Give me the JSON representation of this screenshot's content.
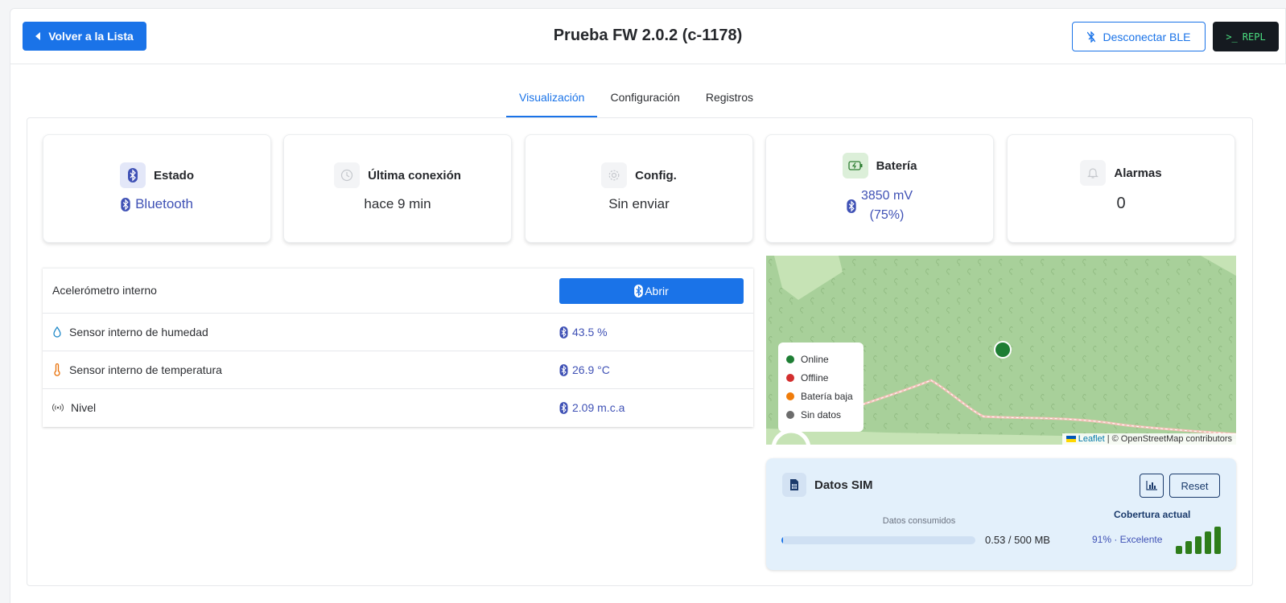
{
  "header": {
    "back_label": "Volver a la Lista",
    "title": "Prueba FW 2.0.2 (c-1178)",
    "ble_label": "Desconectar BLE",
    "repl_label": "REPL"
  },
  "tabs": [
    {
      "label": "Visualización",
      "active": true
    },
    {
      "label": "Configuración",
      "active": false
    },
    {
      "label": "Registros",
      "active": false
    }
  ],
  "cards": {
    "estado": {
      "title": "Estado",
      "value": "Bluetooth"
    },
    "ultima": {
      "title": "Última conexión",
      "value": "hace 9 min"
    },
    "config": {
      "title": "Config.",
      "value": "Sin enviar"
    },
    "bateria": {
      "title": "Batería",
      "value_line1": "3850 mV",
      "value_line2": "(75%)"
    },
    "alarmas": {
      "title": "Alarmas",
      "value": "0"
    }
  },
  "sensors": {
    "accel": {
      "label": "Acelerómetro interno",
      "button": "Abrir"
    },
    "humidity": {
      "label": "Sensor interno de humedad",
      "value": "43.5 %"
    },
    "temperature": {
      "label": "Sensor interno de temperatura",
      "value": "26.9 °C"
    },
    "level": {
      "label": "Nivel",
      "value": "2.09 m.c.a"
    }
  },
  "map": {
    "legend": [
      {
        "label": "Online",
        "color": "#1e7e34"
      },
      {
        "label": "Offline",
        "color": "#d32f2f"
      },
      {
        "label": "Batería baja",
        "color": "#f07c0a"
      },
      {
        "label": "Sin datos",
        "color": "#6c6c6c"
      }
    ],
    "marker_color": "#1e7e34",
    "attribution_link": "Leaflet",
    "attribution_text": "| © OpenStreetMap contributors"
  },
  "sim": {
    "title": "Datos SIM",
    "reset_label": "Reset",
    "consumed_label": "Datos consumidos",
    "usage_text": "0.53 / 500 MB",
    "usage_fraction": 0.00106,
    "coverage_title": "Cobertura actual",
    "coverage_value": "91% · Excelente",
    "signal_bars": 5,
    "signal_color": "#2e7d1a"
  },
  "colors": {
    "primary": "#1a73e8",
    "link": "#3f51b5",
    "repl_bg": "#151a20",
    "repl_text": "#4ade80",
    "map_bg": "#a8d09a"
  }
}
